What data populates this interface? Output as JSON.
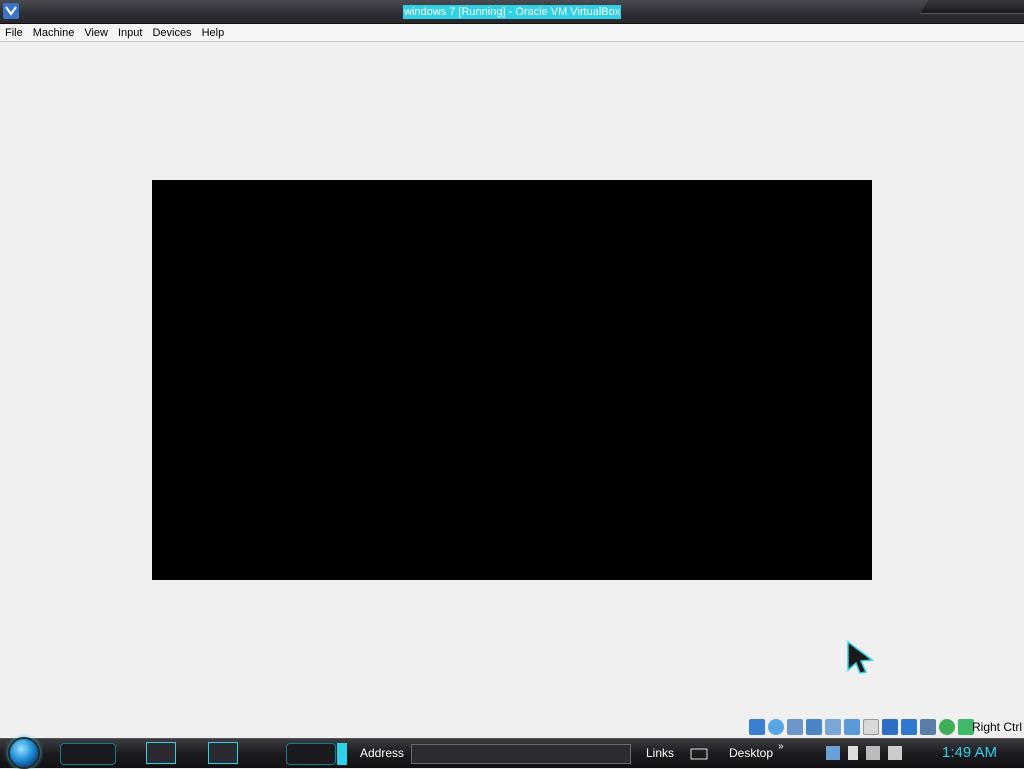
{
  "window": {
    "title": "windows 7 [Running] - Oracle VM VirtualBox"
  },
  "menu": [
    "File",
    "Machine",
    "View",
    "Input",
    "Devices",
    "Help"
  ],
  "vm": {
    "screen_color": "#000000",
    "background_color": "#f0f0f0"
  },
  "status": {
    "icons": [
      "hard-disk-icon",
      "optical-drive-icon",
      "audio-icon",
      "network-icon",
      "usb-icon",
      "shared-folders-icon",
      "display-icon",
      "video-capture-icon",
      "recording-icon",
      "cpu-icon",
      "mouse-integration-icon",
      "keyboard-capture-icon"
    ],
    "host_key": "Right Ctrl"
  },
  "taskbar": {
    "address_label": "Address",
    "links_label": "Links",
    "desktop_label": "Desktop",
    "chevron": "»",
    "clock": "1:49 AM",
    "accent": "#2fd1e6"
  }
}
